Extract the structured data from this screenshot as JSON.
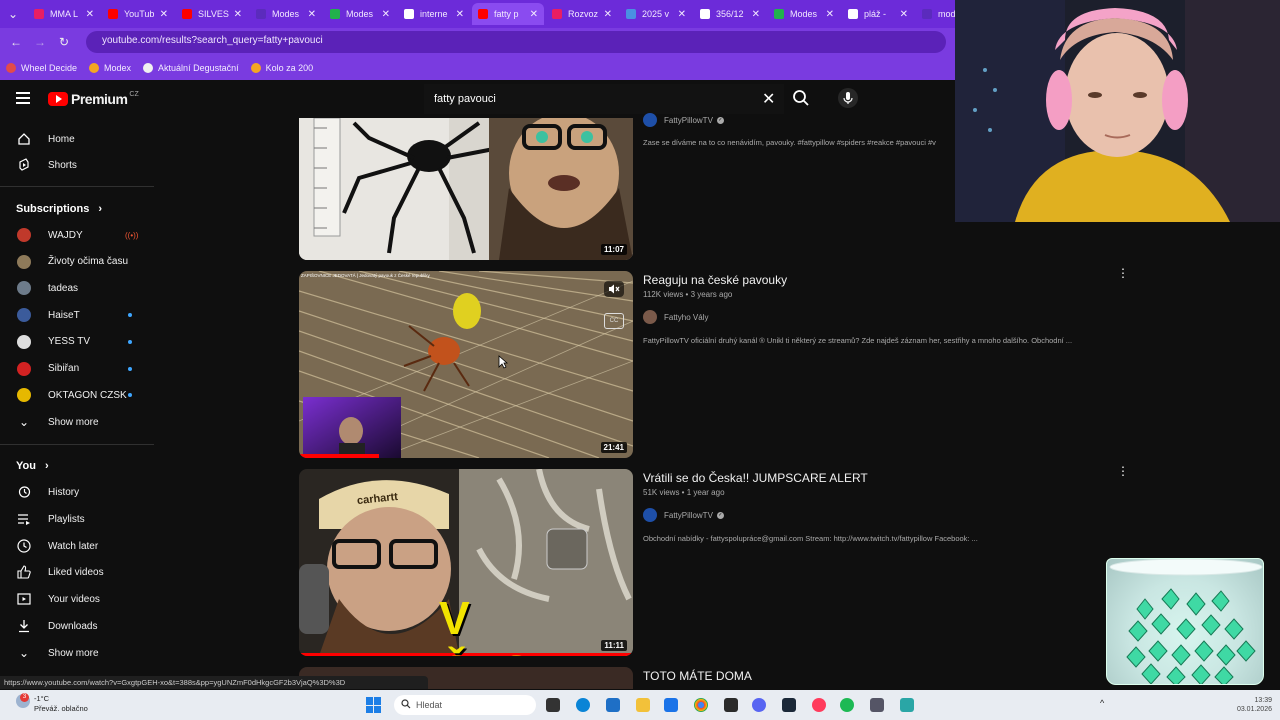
{
  "browser": {
    "tabs": [
      {
        "label": "MMA L",
        "color": "#e91e63"
      },
      {
        "label": "YouTub",
        "color": "#ff0000"
      },
      {
        "label": "SILVES",
        "color": "#ff0000"
      },
      {
        "label": "Modes",
        "color": "#5b2bbd"
      },
      {
        "label": "Modes",
        "color": "#22b14c"
      },
      {
        "label": "interne",
        "color": "#ffffff"
      },
      {
        "label": "fatty p",
        "color": "#ff0000"
      },
      {
        "label": "Rozvoz",
        "color": "#e91e63"
      },
      {
        "label": "2025 v",
        "color": "#4a90e2"
      },
      {
        "label": "356/12",
        "color": "#ffffff"
      },
      {
        "label": "Modes",
        "color": "#22b14c"
      },
      {
        "label": "pláž -",
        "color": "#ffffff"
      },
      {
        "label": "mode",
        "color": "#5b2bbd"
      }
    ],
    "url": "youtube.com/results?search_query=fatty+pavouci",
    "bookmarks": [
      {
        "label": "Wheel Decide",
        "color": "#e34b4b"
      },
      {
        "label": "Modex",
        "color": "#f4a623"
      },
      {
        "label": "Aktuální Degustační",
        "color": "#f0f0f0"
      },
      {
        "label": "Kolo za 200",
        "color": "#f4a623"
      }
    ]
  },
  "header": {
    "logo_text": "Premium",
    "country": "CZ",
    "search_query": "fatty pavouci"
  },
  "sidebar": {
    "main": [
      {
        "label": "Home",
        "icon": "home-icon"
      },
      {
        "label": "Shorts",
        "icon": "shorts-icon"
      }
    ],
    "subscriptions_title": "Subscriptions",
    "subscriptions": [
      {
        "label": "WAJDY",
        "color": "#c0392b",
        "badge": "live"
      },
      {
        "label": "Životy očima času",
        "color": "#8e7a5a",
        "badge": ""
      },
      {
        "label": "tadeas",
        "color": "#6d7b8a",
        "badge": ""
      },
      {
        "label": "HaiseT",
        "color": "#3b5b9b",
        "badge": "dot"
      },
      {
        "label": "YESS TV",
        "color": "#dddddd",
        "badge": "dot"
      },
      {
        "label": "Sibiřan",
        "color": "#d22222",
        "badge": "dot"
      },
      {
        "label": "OKTAGON CZSK",
        "color": "#e6b800",
        "badge": "dot"
      }
    ],
    "show_more_1": "Show more",
    "you_title": "You",
    "you": [
      {
        "label": "History",
        "icon": "history-icon"
      },
      {
        "label": "Playlists",
        "icon": "playlists-icon"
      },
      {
        "label": "Watch later",
        "icon": "watch-later-icon"
      },
      {
        "label": "Liked videos",
        "icon": "liked-icon"
      },
      {
        "label": "Your videos",
        "icon": "your-videos-icon"
      },
      {
        "label": "Downloads",
        "icon": "downloads-icon"
      }
    ],
    "show_more_2": "Show more"
  },
  "results": [
    {
      "title": "",
      "views": "",
      "channel": "FattyPillowTV",
      "verified": true,
      "description": "Zase se díváme na to co nenávidím, pavouky. #fattypillow #spiders #reakce #pavouci #v",
      "duration": "11:07"
    },
    {
      "title": "Reaguju na české pavouky",
      "views": "112K views • 3 years ago",
      "channel": "Fattyho Vály",
      "verified": false,
      "description": "FattyPillowTV oficiální druhý kanál ® Unikl ti některý ze streamů? Zde najdeš záznam her, sestřihy a mnoho dalšího. Obchodní ...",
      "duration": "21:41",
      "thumb_caption": "ZAPIŠOVNICE JEDOVATÁ | Jedovatý pavouk z České republiky"
    },
    {
      "title": "Vrátili se do Česka!! JUMPSCARE ALERT",
      "views": "51K views • 1 year ago",
      "channel": "FattyPillowTV",
      "verified": true,
      "description": "Obchodní nabídky - fattyspolupráce@gmail.com Stream: http://www.twitch.tv/fattypillow Facebook: ...",
      "duration": "11:11",
      "thumb_text": "V ČESKU!",
      "cap_text": "carhartt"
    },
    {
      "title": "TOTO MÁTE DOMA",
      "views": "",
      "channel": "",
      "description": "",
      "duration": ""
    }
  ],
  "status_url": "https://www.youtube.com/watch?v=GxgtpGEH-xo&t=388s&pp=ygUNZmF0dHkgcGF2b3VjaQ%3D%3D",
  "taskbar": {
    "weather_temp": "-1°C",
    "weather_desc": "Převáž. oblačno",
    "notification_count": "3",
    "search_label": "Hledat",
    "time": "13:39",
    "date": "03.01.2026"
  }
}
